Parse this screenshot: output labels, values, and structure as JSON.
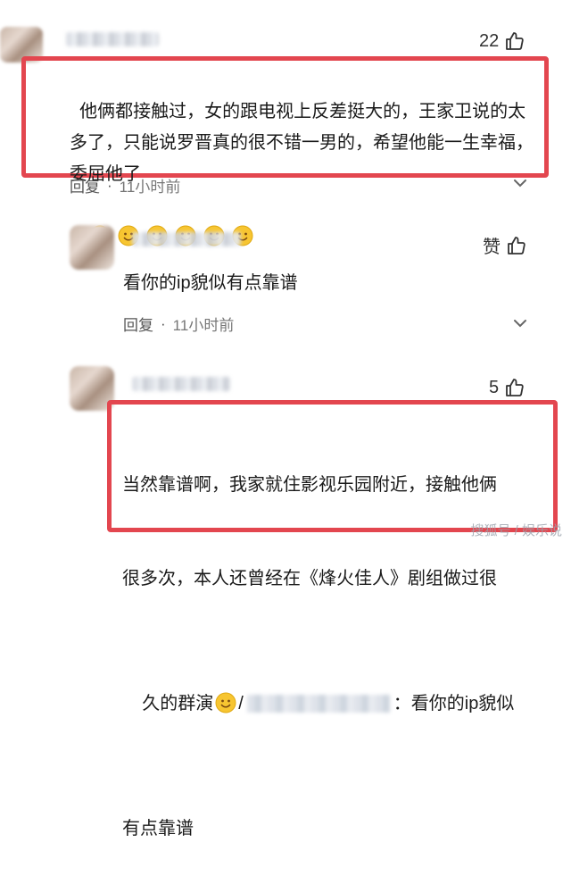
{
  "comments": [
    {
      "likes": "22",
      "text": "他俩都接触过，女的跟电视上反差挺大的，王家卫说的太多了，只能说罗晋真的很不错一男的，希望他能一生幸福，委屈他了",
      "reply_label": "回复",
      "time": "11小时前"
    },
    {
      "likes": "赞",
      "text": "看你的ip貌似有点靠谱",
      "reply_label": "回复",
      "time": "11小时前"
    },
    {
      "likes": "5",
      "text_line1": "当然靠谱啊，我家就住影视乐园附近，接触他俩",
      "text_line2": "很多次，本人还曾经在《烽火佳人》剧组做过很",
      "text_line3_a": "久的群演",
      "text_line3_b": "：看你的ip貌似",
      "text_line4": "有点靠谱"
    }
  ],
  "emoji_name": "smile-emoji",
  "watermark": "搜狐号 / 娱乐说"
}
